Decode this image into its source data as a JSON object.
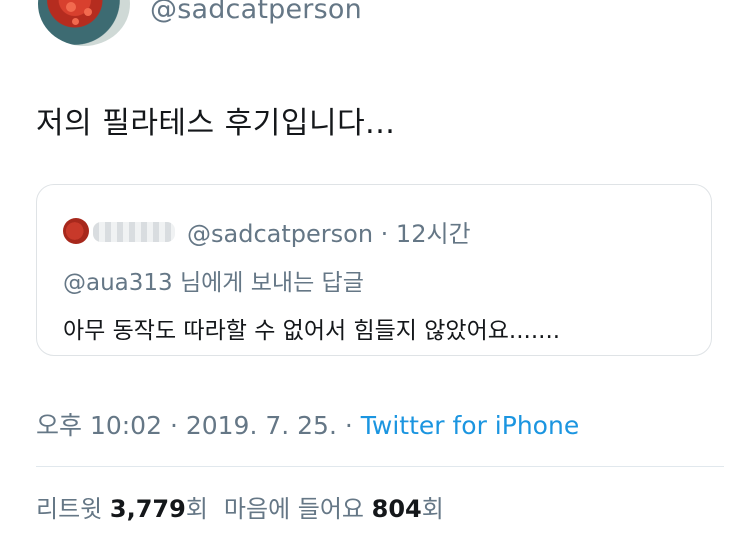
{
  "author": {
    "handle": "@sadcatperson"
  },
  "tweet": {
    "text": "저의 필라테스 후기입니다...",
    "timestamp": "오후 10:02 · 2019. 7. 25. · ",
    "source": "Twitter for iPhone"
  },
  "quoted_tweet": {
    "handle": "@sadcatperson",
    "separator": " · ",
    "time": "12시간",
    "reply_to": "@aua313 님에게 보내는 답글",
    "text": "아무 동작도 따라할 수 없어서 힘들지 않았어요......."
  },
  "stats": {
    "retweets_label": "리트윗",
    "retweets_count": "3,779",
    "retweets_unit": "회",
    "likes_label": "마음에 들어요",
    "likes_count": "804",
    "likes_unit": "회"
  }
}
